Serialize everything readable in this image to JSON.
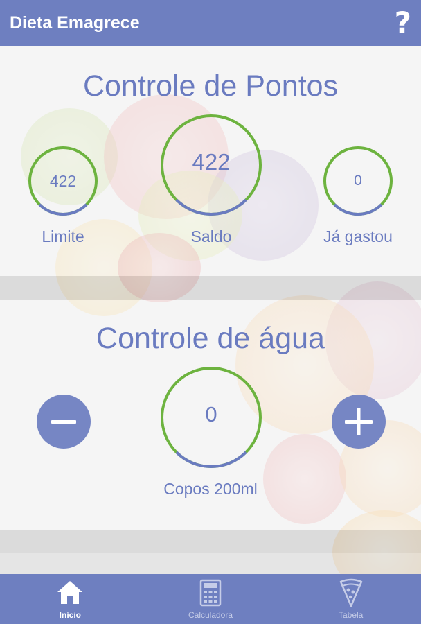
{
  "header": {
    "title": "Dieta Emagrece",
    "help_label": "?"
  },
  "points": {
    "title": "Controle de Pontos",
    "limit": {
      "value": "422",
      "label": "Limite",
      "progress": 0.25
    },
    "balance": {
      "value": "422",
      "label": "Saldo",
      "progress": 0.25
    },
    "spent": {
      "value": "0",
      "label": "Já gastou",
      "progress": 0.25
    }
  },
  "water": {
    "title": "Controle de água",
    "cups": {
      "value": "0",
      "label": "Copos 200ml",
      "progress": 0.25
    }
  },
  "nav": {
    "items": [
      {
        "label": "Início",
        "icon": "home-icon",
        "active": true
      },
      {
        "label": "Calculadora",
        "icon": "calculator-icon",
        "active": false
      },
      {
        "label": "Tabela",
        "icon": "pizza-icon",
        "active": false
      }
    ]
  },
  "colors": {
    "primary": "#6e7fc0",
    "text": "#6a7bc0",
    "ring_green": "#6db33f",
    "ring_blue": "#6a7bc0"
  }
}
